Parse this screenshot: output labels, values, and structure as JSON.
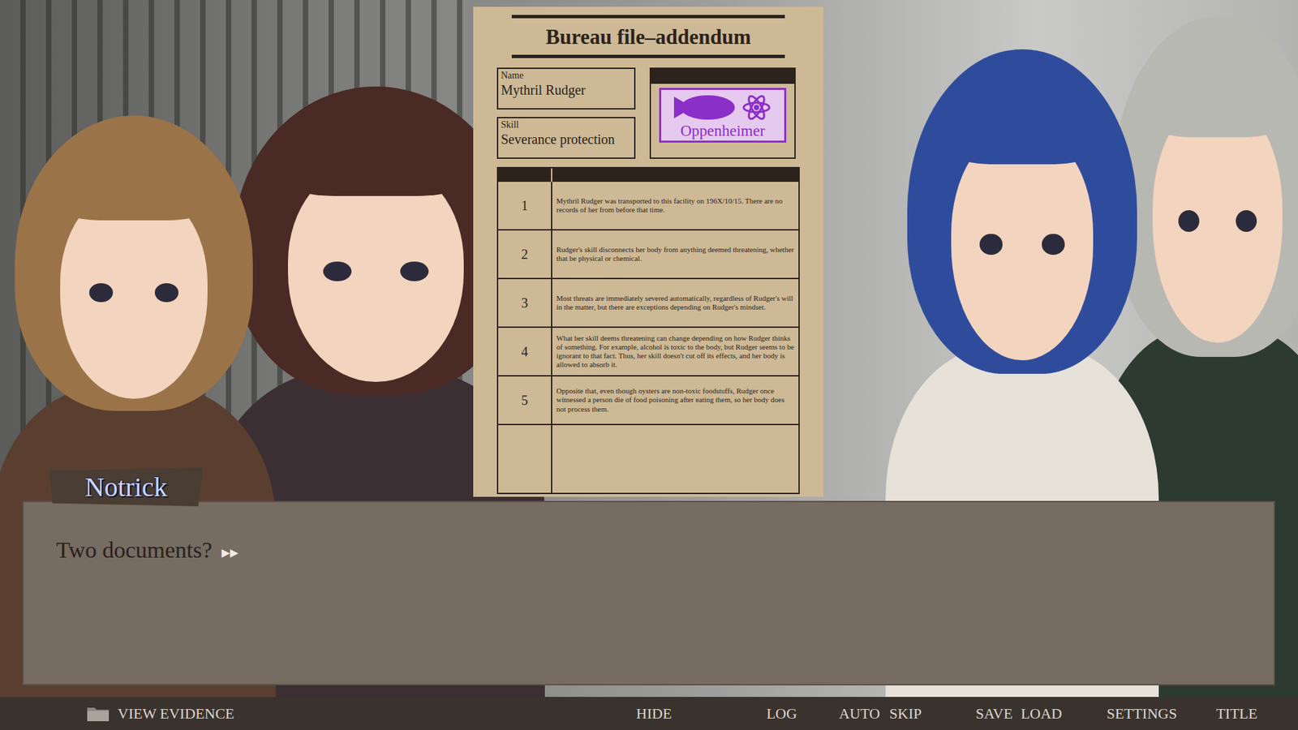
{
  "document": {
    "title": "Bureau file–addendum",
    "fields": [
      {
        "label": "Name",
        "value": "Mythril Rudger"
      },
      {
        "label": "Skill",
        "value": "Severance protection"
      }
    ],
    "stamp": "Oppenheimer",
    "entries": [
      {
        "number": "1",
        "text": "Mythril Rudger was transported to this facility on 196X/10/15. There are no records of her from before that time."
      },
      {
        "number": "2",
        "text": "Rudger's skill disconnects her body from anything deemed threatening, whether that be physical or chemical."
      },
      {
        "number": "3",
        "text": "Most threats are immediately severed automatically, regardless of Rudger's will in the matter, but there are exceptions depending on Rudger's mindset."
      },
      {
        "number": "4",
        "text": "What her skill deems threatening can change depending on how Rudger thinks of something. For example, alcohol is toxic to the body, but Rudger seems to be ignorant to that fact. Thus, her skill doesn't cut off its effects, and her body is allowed to absorb it."
      },
      {
        "number": "5",
        "text": "Opposite that, even though oysters are non-toxic foodstuffs, Rudger once witnessed a person die of food poisoning after eating them, so her body does not process them."
      }
    ]
  },
  "characters": [
    {
      "color": "#9a7448"
    },
    {
      "color": "#4a2a24"
    },
    {
      "color": "#2f4c9c"
    },
    {
      "color": "#b8b8b2"
    }
  ],
  "dialogue": {
    "speaker": "Notrick",
    "text": "Two documents?",
    "advance": "▶▶"
  },
  "menu": [
    {
      "label": "VIEW EVIDENCE",
      "kind": "evidence"
    },
    {
      "label": "HIDE",
      "kind": "plain"
    },
    {
      "label": "LOG",
      "kind": "plain"
    },
    {
      "label": "AUTO",
      "kind": "plain"
    },
    {
      "label": "SKIP",
      "kind": "plain"
    },
    {
      "label": "SAVE",
      "kind": "plain"
    },
    {
      "label": "LOAD",
      "kind": "plain"
    },
    {
      "label": "SETTINGS",
      "kind": "plain"
    },
    {
      "label": "TITLE",
      "kind": "plain"
    }
  ]
}
